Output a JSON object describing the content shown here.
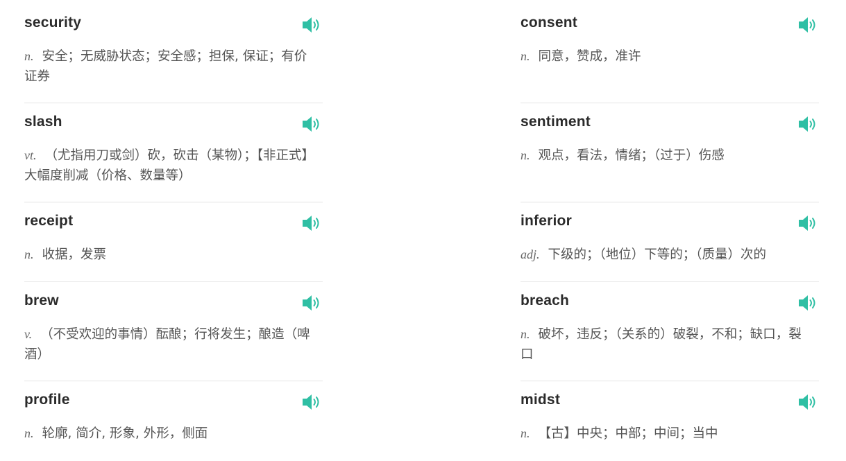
{
  "icons": {
    "speaker": "speaker-icon",
    "accent_color": "#2fbfa4"
  },
  "left": [
    {
      "word": "security",
      "pos": "n.",
      "meaning": "安全；无威胁状态；安全感；担保, 保证；有价证券"
    },
    {
      "word": "slash",
      "pos": "vt.",
      "meaning": "（尤指用刀或剑）砍，砍击（某物）；【非正式】大幅度削减（价格、数量等）"
    },
    {
      "word": "receipt",
      "pos": "n.",
      "meaning": "收据，发票"
    },
    {
      "word": "brew",
      "pos": "v.",
      "meaning": "（不受欢迎的事情）酝酿；行将发生；酿造（啤酒）"
    },
    {
      "word": "profile",
      "pos": "n.",
      "meaning": "轮廓, 简介, 形象, 外形，侧面"
    }
  ],
  "right": [
    {
      "word": "consent",
      "pos": "n.",
      "meaning": "同意，赞成，准许"
    },
    {
      "word": "sentiment",
      "pos": "n.",
      "meaning": "观点，看法，情绪；（过于）伤感"
    },
    {
      "word": "inferior",
      "pos": "adj.",
      "meaning": "下级的；（地位）下等的；（质量）次的"
    },
    {
      "word": "breach",
      "pos": "n.",
      "meaning": "破坏，违反；（关系的）破裂，不和；缺口，裂口"
    },
    {
      "word": "midst",
      "pos": "n.",
      "meaning": "【古】中央；中部；中间；当中"
    }
  ]
}
